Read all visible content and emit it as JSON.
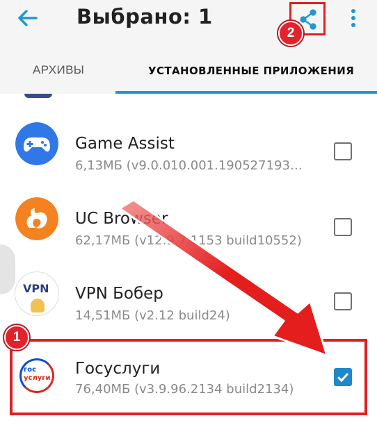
{
  "appbar": {
    "title": "Выбрано: 1",
    "back_icon": "arrow-left-icon",
    "share_icon": "share-icon",
    "more_icon": "more-vertical-icon"
  },
  "tabs": [
    {
      "label": "АРХИВЫ",
      "selected": false
    },
    {
      "label": "УСТАНОВЛЕННЫЕ ПРИЛОЖЕНИЯ",
      "selected": true
    }
  ],
  "apps": [
    {
      "name": "Game Assist",
      "meta": "6,13МБ (v9.0.010.001.190527193…",
      "checked": false,
      "icon": "gamepad-icon",
      "icon_color": "#2f78e6"
    },
    {
      "name": "UC Browser",
      "meta": "62,17МБ (v12.9.7.1153 build10552)",
      "checked": false,
      "icon": "squirrel-icon",
      "icon_color": "#f58220"
    },
    {
      "name": "VPN Бобер",
      "meta": "14,51МБ (v2.12 build24)",
      "checked": false,
      "icon": "vpn-beaver-icon",
      "icon_color": "#ffffff"
    },
    {
      "name": "Госуслуги",
      "meta": "76,40МБ (v3.9.96.2134 build2134)",
      "checked": true,
      "icon": "gosuslugi-logo-icon",
      "icon_color": "#ffffff"
    }
  ],
  "vpn_icon_text": "VPN",
  "gosuslugi_logo_text": [
    "гос",
    "услуги"
  ],
  "annotations": {
    "step1": "1",
    "step2": "2",
    "highlight_color": "#e02020"
  },
  "colors": {
    "accent": "#2196d3",
    "checkbox_checked": "#1e88c8",
    "appbar_bg": "#f5f5f5"
  }
}
